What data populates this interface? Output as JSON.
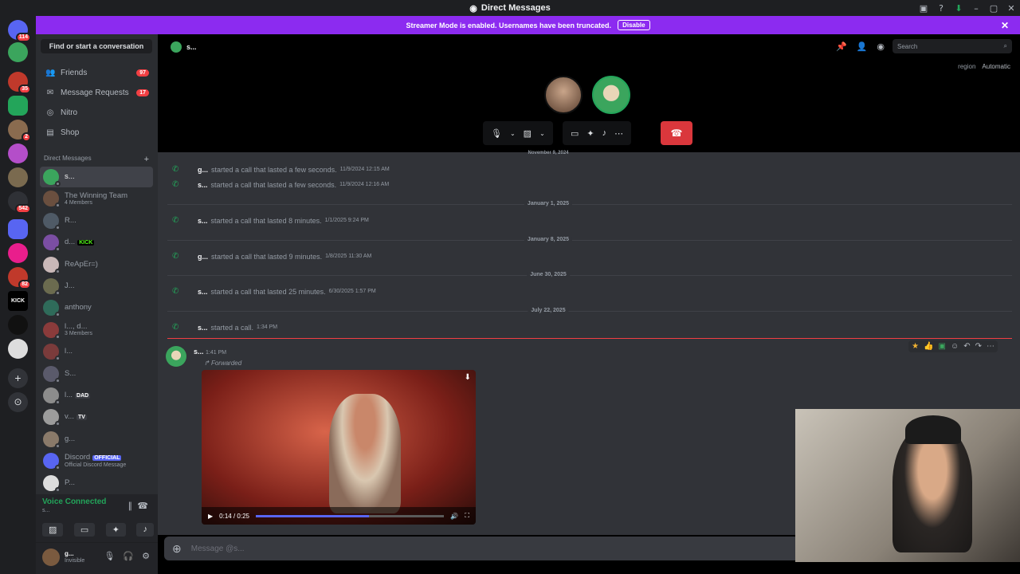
{
  "titlebar": {
    "title": "Direct Messages"
  },
  "banner": {
    "text": "Streamer Mode is enabled. Usernames have been truncated.",
    "button": "Disable"
  },
  "servers": [
    {
      "badge": "114"
    },
    {
      "badge": ""
    },
    {
      "badge": "35"
    },
    {
      "badge": ""
    },
    {
      "badge": "2"
    },
    {
      "badge": ""
    },
    {
      "badge": ""
    },
    {
      "badge": "542"
    },
    {
      "badge": ""
    },
    {
      "badge": ""
    },
    {
      "badge": "82"
    },
    {
      "badge": "KICK"
    },
    {
      "badge": ""
    },
    {
      "badge": ""
    }
  ],
  "sidebar": {
    "find": "Find or start a conversation",
    "nav": [
      {
        "label": "Friends",
        "count": "97"
      },
      {
        "label": "Message Requests",
        "count": "17"
      },
      {
        "label": "Nitro",
        "count": ""
      },
      {
        "label": "Shop",
        "count": ""
      }
    ],
    "dm_header": "Direct Messages",
    "dms": [
      {
        "name": "s...",
        "sub": "",
        "tag": "",
        "color": "#3ba55d"
      },
      {
        "name": "The Winning Team",
        "sub": "4 Members",
        "tag": "",
        "color": "#6a4f3f"
      },
      {
        "name": "R...",
        "sub": "",
        "tag": "",
        "color": "#4f5a66"
      },
      {
        "name": "d...",
        "sub": "",
        "tag": "KICK",
        "color": "#7b4ea3"
      },
      {
        "name": "ReApEr=)",
        "sub": "",
        "tag": "",
        "color": "#c9b8b8"
      },
      {
        "name": "J...",
        "sub": "",
        "tag": "",
        "color": "#6b6b4f"
      },
      {
        "name": "anthony",
        "sub": "",
        "tag": "",
        "color": "#2f6b5a"
      },
      {
        "name": "l..., d...",
        "sub": "3 Members",
        "tag": "",
        "color": "#8a3b3b"
      },
      {
        "name": "l...",
        "sub": "",
        "tag": "",
        "color": "#7a3b3b"
      },
      {
        "name": "S...",
        "sub": "",
        "tag": "",
        "color": "#5a5a6b"
      },
      {
        "name": "l...",
        "sub": "",
        "tag": "DAD",
        "color": "#8c8c8c"
      },
      {
        "name": "v...",
        "sub": "",
        "tag": "TV",
        "color": "#9c9c9c"
      },
      {
        "name": "g...",
        "sub": "",
        "tag": "",
        "color": "#8a7a6a"
      },
      {
        "name": "Discord",
        "sub": "Official Discord Message",
        "tag": "OFFICIAL",
        "color": "#5865f2"
      },
      {
        "name": "P...",
        "sub": "",
        "tag": "",
        "color": "#ddd"
      }
    ],
    "voice": {
      "status": "Voice Connected",
      "sub": "s..."
    },
    "user": {
      "name": "g...",
      "status": "Invisible"
    }
  },
  "main": {
    "header_name": "s...",
    "search_placeholder": "Search",
    "region_label": "region",
    "region_value": "Automatic",
    "date_top": "November 9, 2024",
    "calls": [
      {
        "user": "g...",
        "text": "started a call that lasted a few seconds.",
        "ts": "11/9/2024 12:15 AM"
      },
      {
        "user": "s...",
        "text": "started a call that lasted a few seconds.",
        "ts": "11/9/2024 12:16 AM"
      },
      {
        "user": "s...",
        "text": "started a call that lasted 8 minutes.",
        "ts": "1/1/2025 9:24 PM"
      },
      {
        "user": "g...",
        "text": "started a call that lasted 9 minutes.",
        "ts": "1/8/2025 11:30 AM"
      },
      {
        "user": "s...",
        "text": "started a call that lasted 25 minutes.",
        "ts": "6/30/2025 1:57 PM"
      },
      {
        "user": "s...",
        "text": "started a call.",
        "ts": "1:34 PM"
      }
    ],
    "dates": [
      "January 1, 2025",
      "January 8, 2025",
      "June 30, 2025",
      "July 22, 2025"
    ],
    "message": {
      "user": "s...",
      "ts": "1:41 PM",
      "forwarded": "Forwarded",
      "video_time": "0:14 / 0:25"
    },
    "input_placeholder": "Message @s..."
  }
}
